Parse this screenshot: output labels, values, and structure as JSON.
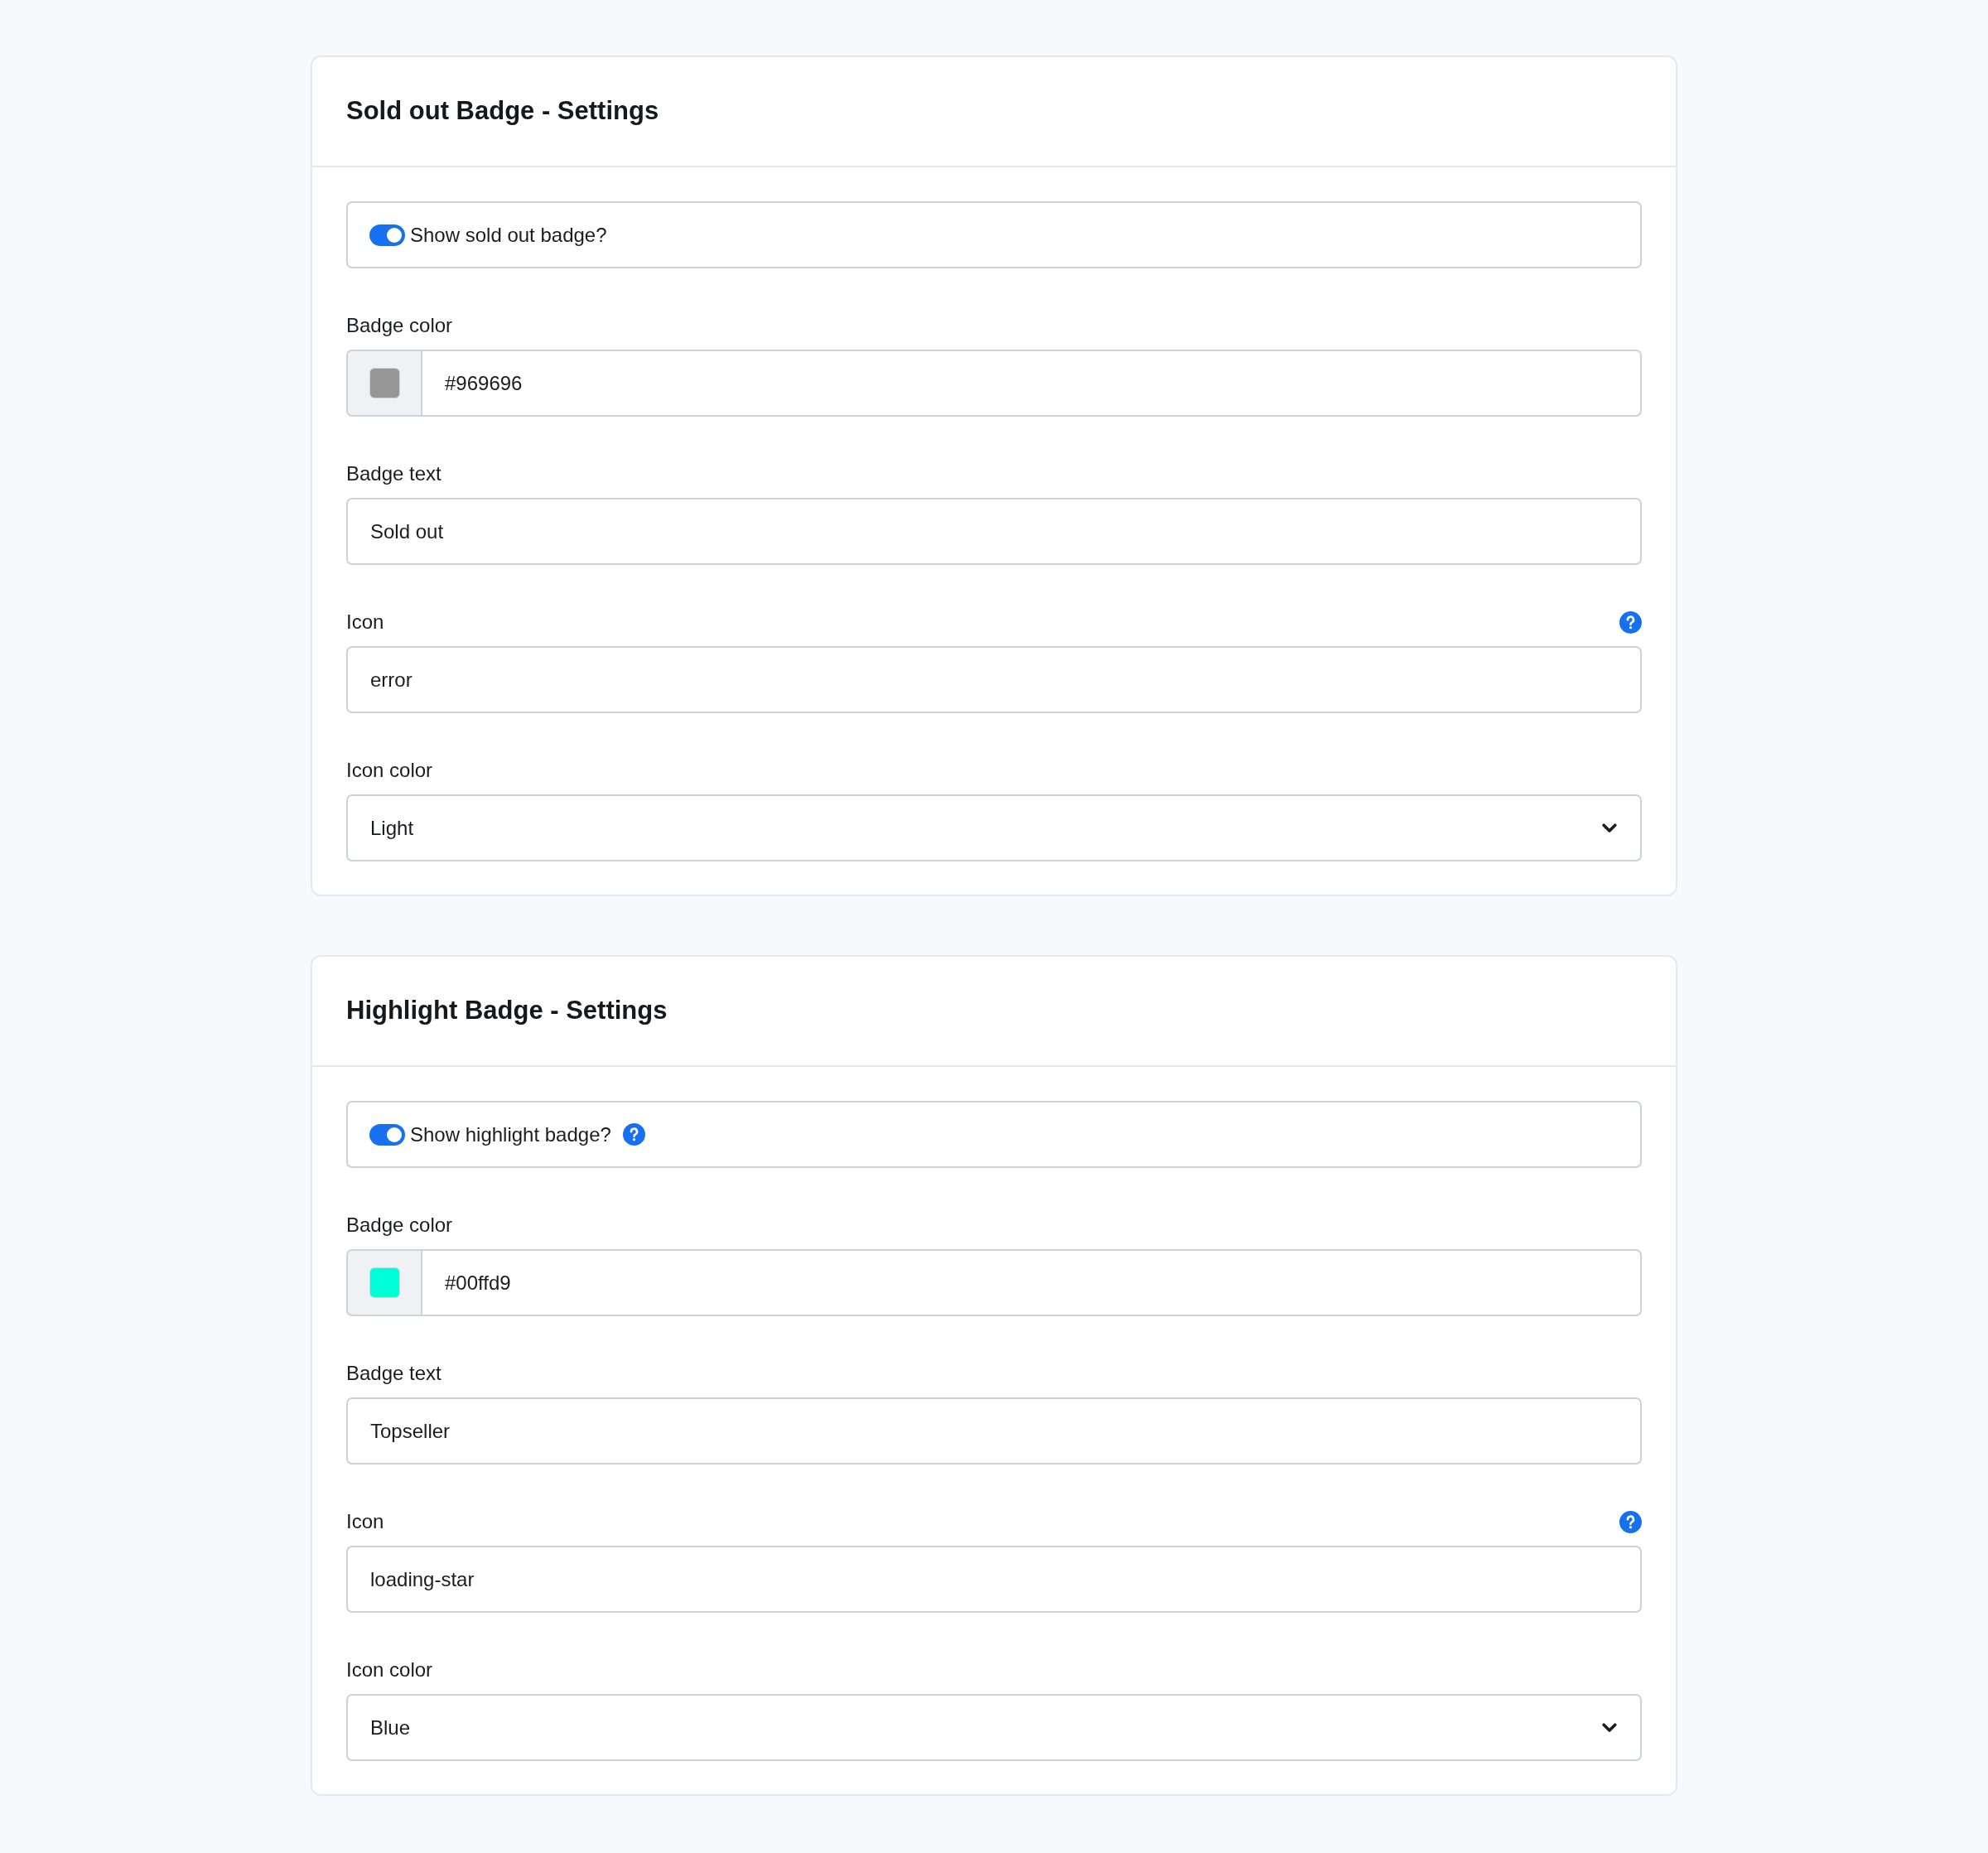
{
  "cards": [
    {
      "title": "Sold out Badge - Settings",
      "fields": [
        {
          "kind": "toggle",
          "label": "Show sold out badge?",
          "on": true,
          "help": false
        },
        {
          "kind": "color",
          "label": "Badge color",
          "value": "#969696",
          "color": "#969696",
          "help": false
        },
        {
          "kind": "text",
          "label": "Badge text",
          "value": "Sold out",
          "help": false
        },
        {
          "kind": "text",
          "label": "Icon",
          "value": "error",
          "help": true
        },
        {
          "kind": "select",
          "label": "Icon color",
          "value": "Light",
          "help": false
        }
      ]
    },
    {
      "title": "Highlight Badge - Settings",
      "fields": [
        {
          "kind": "toggle",
          "label": "Show highlight badge?",
          "on": true,
          "help": true
        },
        {
          "kind": "color",
          "label": "Badge color",
          "value": "#00ffd9",
          "color": "#00ffd9",
          "help": false
        },
        {
          "kind": "text",
          "label": "Badge text",
          "value": "Topseller",
          "help": false
        },
        {
          "kind": "text",
          "label": "Icon",
          "value": "loading-star",
          "help": true
        },
        {
          "kind": "select",
          "label": "Icon color",
          "value": "Blue",
          "help": false
        }
      ]
    }
  ]
}
